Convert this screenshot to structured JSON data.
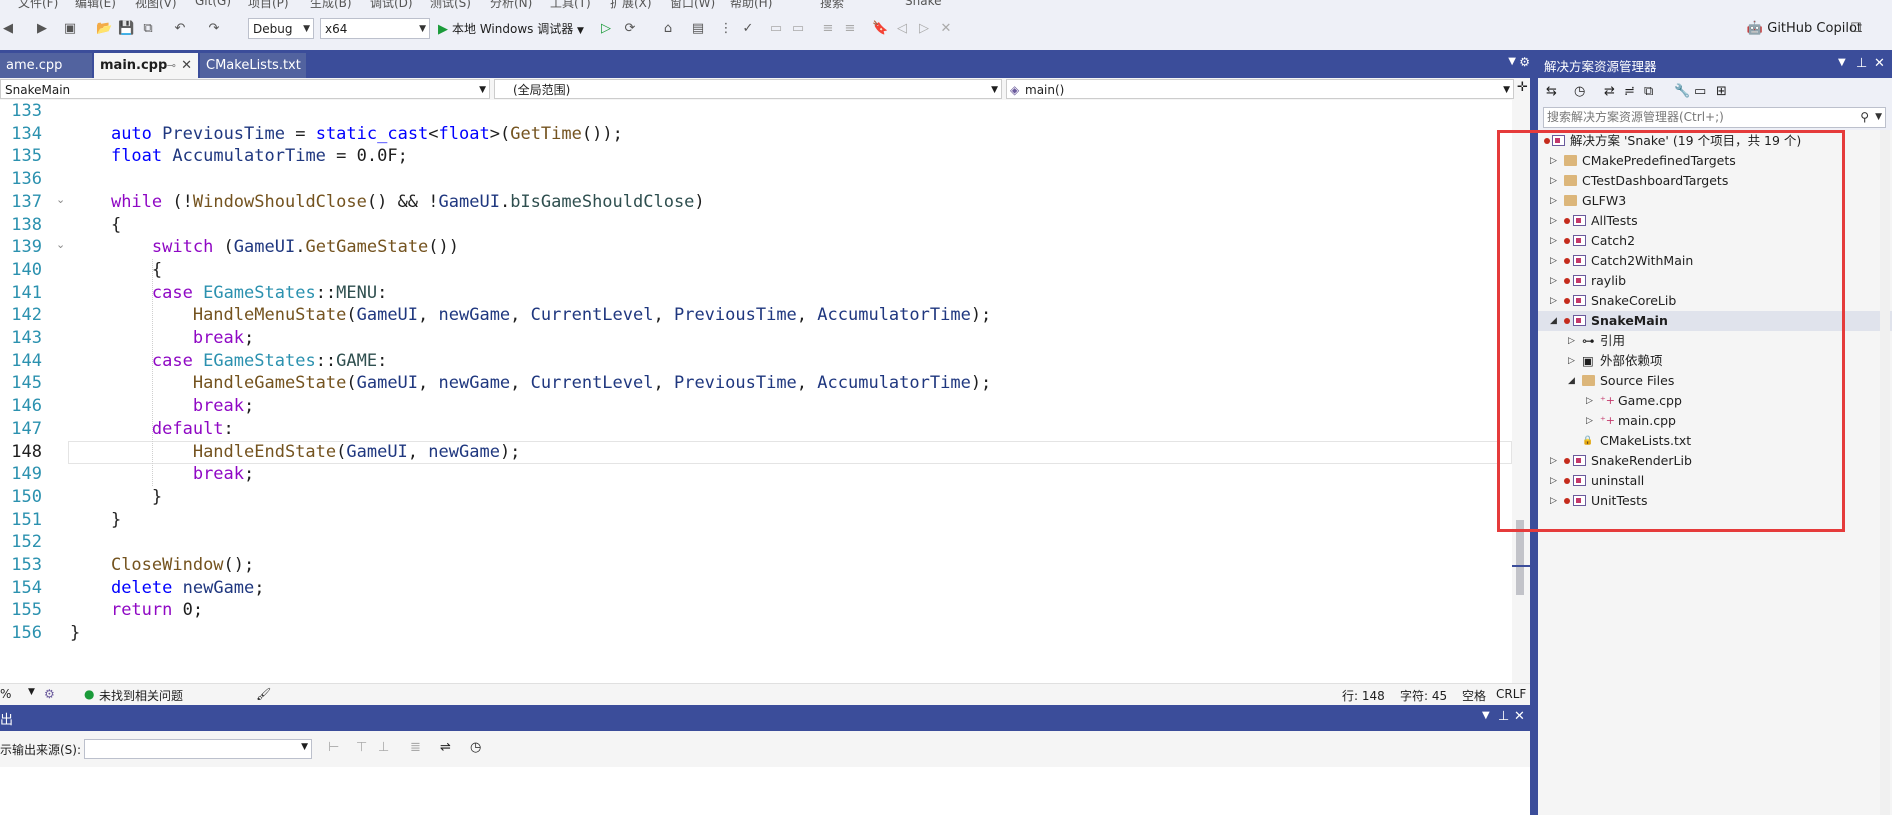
{
  "menubar": {
    "items": [
      "文件(F)",
      "编辑(E)",
      "视图(V)",
      "Git(G)",
      "项目(P)",
      "生成(B)",
      "调试(D)",
      "测试(S)",
      "分析(N)",
      "工具(T)",
      "扩展(X)",
      "窗口(W)",
      "帮助(H)",
      "搜索",
      "Snake"
    ]
  },
  "toolbar": {
    "config": "Debug",
    "platform": "x64",
    "run_label": "本地 Windows 调试器",
    "copilot_label": "GitHub Copilot"
  },
  "tabs": [
    {
      "label": "ame.cpp",
      "active": false
    },
    {
      "label": "main.cpp",
      "active": true
    },
    {
      "label": "CMakeLists.txt",
      "active": false
    }
  ],
  "navbar": {
    "project": "SnakeMain",
    "scope": "(全局范围)",
    "member": "main()"
  },
  "code": {
    "current_line": 148,
    "lines": [
      {
        "n": "133",
        "t": []
      },
      {
        "n": "134",
        "t": [
          [
            "",
            "    "
          ],
          [
            "kw",
            "auto"
          ],
          [
            "",
            " "
          ],
          [
            "var",
            "PreviousTime"
          ],
          [
            "",
            " = "
          ],
          [
            "kw",
            "static_cast"
          ],
          [
            "",
            "<"
          ],
          [
            "kw",
            "float"
          ],
          [
            "",
            ">("
          ],
          [
            "fn",
            "GetTime"
          ],
          [
            "",
            "());"
          ]
        ]
      },
      {
        "n": "135",
        "t": [
          [
            "",
            "    "
          ],
          [
            "kw",
            "float"
          ],
          [
            "",
            " "
          ],
          [
            "var",
            "AccumulatorTime"
          ],
          [
            "",
            " = 0.0F;"
          ]
        ]
      },
      {
        "n": "136",
        "t": []
      },
      {
        "n": "137",
        "t": [
          [
            "",
            "    "
          ],
          [
            "kwc",
            "while"
          ],
          [
            "",
            " (!"
          ],
          [
            "fn",
            "WindowShouldClose"
          ],
          [
            "",
            "() && !"
          ],
          [
            "var",
            "GameUI"
          ],
          [
            "",
            "."
          ],
          [
            "en",
            "bIsGameShouldClose"
          ],
          [
            "",
            ")"
          ]
        ]
      },
      {
        "n": "138",
        "t": [
          [
            "",
            "    {"
          ]
        ]
      },
      {
        "n": "139",
        "t": [
          [
            "",
            "        "
          ],
          [
            "kwc",
            "switch"
          ],
          [
            "",
            " ("
          ],
          [
            "var",
            "GameUI"
          ],
          [
            "",
            "."
          ],
          [
            "fn",
            "GetGameState"
          ],
          [
            "",
            "())"
          ]
        ]
      },
      {
        "n": "140",
        "t": [
          [
            "",
            "        {"
          ]
        ]
      },
      {
        "n": "141",
        "t": [
          [
            "",
            "        "
          ],
          [
            "kwc",
            "case"
          ],
          [
            "",
            " "
          ],
          [
            "ty",
            "EGameStates"
          ],
          [
            "",
            "::"
          ],
          [
            "en",
            "MENU"
          ],
          [
            "",
            ":"
          ]
        ]
      },
      {
        "n": "142",
        "t": [
          [
            "",
            "            "
          ],
          [
            "fn",
            "HandleMenuState"
          ],
          [
            "",
            "("
          ],
          [
            "var",
            "GameUI"
          ],
          [
            "",
            ", "
          ],
          [
            "var",
            "newGame"
          ],
          [
            "",
            ", "
          ],
          [
            "var",
            "CurrentLevel"
          ],
          [
            "",
            ", "
          ],
          [
            "var",
            "PreviousTime"
          ],
          [
            "",
            ", "
          ],
          [
            "var",
            "AccumulatorTime"
          ],
          [
            "",
            ");"
          ]
        ]
      },
      {
        "n": "143",
        "t": [
          [
            "",
            "            "
          ],
          [
            "kwc",
            "break"
          ],
          [
            "",
            ";"
          ]
        ]
      },
      {
        "n": "144",
        "t": [
          [
            "",
            "        "
          ],
          [
            "kwc",
            "case"
          ],
          [
            "",
            " "
          ],
          [
            "ty",
            "EGameStates"
          ],
          [
            "",
            "::"
          ],
          [
            "en",
            "GAME"
          ],
          [
            "",
            ":"
          ]
        ]
      },
      {
        "n": "145",
        "t": [
          [
            "",
            "            "
          ],
          [
            "fn",
            "HandleGameState"
          ],
          [
            "",
            "("
          ],
          [
            "var",
            "GameUI"
          ],
          [
            "",
            ", "
          ],
          [
            "var",
            "newGame"
          ],
          [
            "",
            ", "
          ],
          [
            "var",
            "CurrentLevel"
          ],
          [
            "",
            ", "
          ],
          [
            "var",
            "PreviousTime"
          ],
          [
            "",
            ", "
          ],
          [
            "var",
            "AccumulatorTime"
          ],
          [
            "",
            ");"
          ]
        ]
      },
      {
        "n": "146",
        "t": [
          [
            "",
            "            "
          ],
          [
            "kwc",
            "break"
          ],
          [
            "",
            ";"
          ]
        ]
      },
      {
        "n": "147",
        "t": [
          [
            "",
            "        "
          ],
          [
            "kwc",
            "default"
          ],
          [
            "",
            ":"
          ]
        ]
      },
      {
        "n": "148",
        "t": [
          [
            "",
            "            "
          ],
          [
            "fn",
            "HandleEndState"
          ],
          [
            "",
            "("
          ],
          [
            "var",
            "GameUI"
          ],
          [
            "",
            ", "
          ],
          [
            "var",
            "newGame"
          ],
          [
            "",
            ");"
          ]
        ]
      },
      {
        "n": "149",
        "t": [
          [
            "",
            "            "
          ],
          [
            "kwc",
            "break"
          ],
          [
            "",
            ";"
          ]
        ]
      },
      {
        "n": "150",
        "t": [
          [
            "",
            "        }"
          ]
        ]
      },
      {
        "n": "151",
        "t": [
          [
            "",
            "    }"
          ]
        ]
      },
      {
        "n": "152",
        "t": []
      },
      {
        "n": "153",
        "t": [
          [
            "",
            "    "
          ],
          [
            "fn",
            "CloseWindow"
          ],
          [
            "",
            "();"
          ]
        ]
      },
      {
        "n": "154",
        "t": [
          [
            "",
            "    "
          ],
          [
            "kw",
            "delete"
          ],
          [
            "",
            " "
          ],
          [
            "var",
            "newGame"
          ],
          [
            "",
            ";"
          ]
        ]
      },
      {
        "n": "155",
        "t": [
          [
            "",
            "    "
          ],
          [
            "kwc",
            "return"
          ],
          [
            "",
            " 0;"
          ]
        ]
      },
      {
        "n": "156",
        "t": [
          [
            "",
            "}"
          ]
        ]
      }
    ]
  },
  "editor_status": {
    "zoom": "%",
    "issues": "未找到相关问题",
    "line": "行: 148",
    "char": "字符: 45",
    "whitespace": "空格",
    "eol": "CRLF"
  },
  "output": {
    "title": "出",
    "source_label": "示输出来源(S):"
  },
  "solution_explorer": {
    "title": "解决方案资源管理器",
    "search_placeholder": "搜索解决方案资源管理器(Ctrl+;)",
    "tree": [
      {
        "label": "解决方案 'Snake' (19 个项目，共 19 个)",
        "level": 0,
        "kind": "solution",
        "expander": ""
      },
      {
        "label": "CMakePredefinedTargets",
        "level": 1,
        "kind": "folder",
        "expander": "closed"
      },
      {
        "label": "CTestDashboardTargets",
        "level": 1,
        "kind": "folder",
        "expander": "closed"
      },
      {
        "label": "GLFW3",
        "level": 1,
        "kind": "folder",
        "expander": "closed"
      },
      {
        "label": "AllTests",
        "level": 1,
        "kind": "project",
        "expander": "closed"
      },
      {
        "label": "Catch2",
        "level": 1,
        "kind": "project",
        "expander": "closed"
      },
      {
        "label": "Catch2WithMain",
        "level": 1,
        "kind": "project",
        "expander": "closed"
      },
      {
        "label": "raylib",
        "level": 1,
        "kind": "project",
        "expander": "closed"
      },
      {
        "label": "SnakeCoreLib",
        "level": 1,
        "kind": "project",
        "expander": "closed"
      },
      {
        "label": "SnakeMain",
        "level": 1,
        "kind": "project",
        "expander": "open",
        "selected": true
      },
      {
        "label": "引用",
        "level": 2,
        "kind": "refs",
        "expander": "closed"
      },
      {
        "label": "外部依赖项",
        "level": 2,
        "kind": "deps",
        "expander": "closed"
      },
      {
        "label": "Source Files",
        "level": 2,
        "kind": "srcfolder",
        "expander": "open"
      },
      {
        "label": "Game.cpp",
        "level": 3,
        "kind": "cpp",
        "expander": "closed"
      },
      {
        "label": "main.cpp",
        "level": 3,
        "kind": "cpp",
        "expander": "closed"
      },
      {
        "label": "CMakeLists.txt",
        "level": 2,
        "kind": "txt",
        "expander": ""
      },
      {
        "label": "SnakeRenderLib",
        "level": 1,
        "kind": "project",
        "expander": "closed"
      },
      {
        "label": "uninstall",
        "level": 1,
        "kind": "project",
        "expander": "closed"
      },
      {
        "label": "UnitTests",
        "level": 1,
        "kind": "project",
        "expander": "closed"
      }
    ]
  },
  "colors": {
    "accent": "#3b4d9a",
    "highlight_box": "#e53b3b",
    "run_green": "#1b9b3a"
  }
}
